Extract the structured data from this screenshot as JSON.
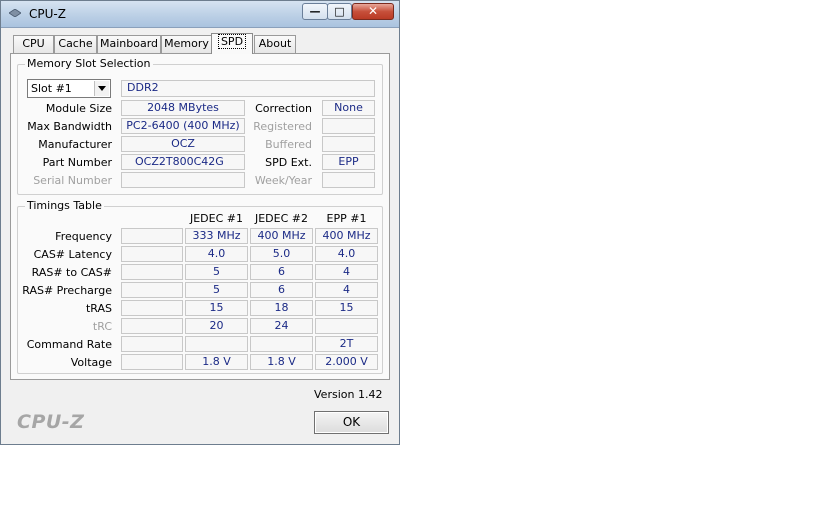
{
  "window": {
    "title": "CPU-Z"
  },
  "tabs": [
    {
      "label": "CPU"
    },
    {
      "label": "Cache"
    },
    {
      "label": "Mainboard"
    },
    {
      "label": "Memory"
    },
    {
      "label": "SPD",
      "active": true
    },
    {
      "label": "About"
    }
  ],
  "slot": {
    "group_title": "Memory Slot Selection",
    "selected": "Slot #1",
    "type": "DDR2",
    "module_size_label": "Module Size",
    "module_size": "2048 MBytes",
    "max_bandwidth_label": "Max Bandwidth",
    "max_bandwidth": "PC2-6400 (400 MHz)",
    "manufacturer_label": "Manufacturer",
    "manufacturer": "OCZ",
    "part_number_label": "Part Number",
    "part_number": "OCZ2T800C42G",
    "serial_number_label": "Serial Number",
    "serial_number": "",
    "correction_label": "Correction",
    "correction": "None",
    "registered_label": "Registered",
    "registered": "",
    "buffered_label": "Buffered",
    "buffered": "",
    "spd_ext_label": "SPD Ext.",
    "spd_ext": "EPP",
    "week_year_label": "Week/Year",
    "week_year": ""
  },
  "timings": {
    "group_title": "Timings Table",
    "columns": [
      "JEDEC #1",
      "JEDEC #2",
      "EPP #1"
    ],
    "rows": [
      {
        "label": "Frequency",
        "values": [
          "333 MHz",
          "400 MHz",
          "400 MHz"
        ]
      },
      {
        "label": "CAS# Latency",
        "values": [
          "4.0",
          "5.0",
          "4.0"
        ]
      },
      {
        "label": "RAS# to CAS#",
        "values": [
          "5",
          "6",
          "4"
        ]
      },
      {
        "label": "RAS# Precharge",
        "values": [
          "5",
          "6",
          "4"
        ]
      },
      {
        "label": "tRAS",
        "values": [
          "15",
          "18",
          "15"
        ]
      },
      {
        "label": "tRC",
        "values": [
          "20",
          "24",
          ""
        ],
        "disabled": true
      },
      {
        "label": "Command Rate",
        "values": [
          "",
          "",
          "2T"
        ]
      },
      {
        "label": "Voltage",
        "values": [
          "1.8 V",
          "1.8 V",
          "2.000 V"
        ]
      }
    ]
  },
  "footer": {
    "version": "Version 1.42",
    "brand": "CPU-Z",
    "ok_label": "OK"
  },
  "colors": {
    "value_text": "#1b2a86",
    "disabled_text": "#a0a0a0"
  }
}
